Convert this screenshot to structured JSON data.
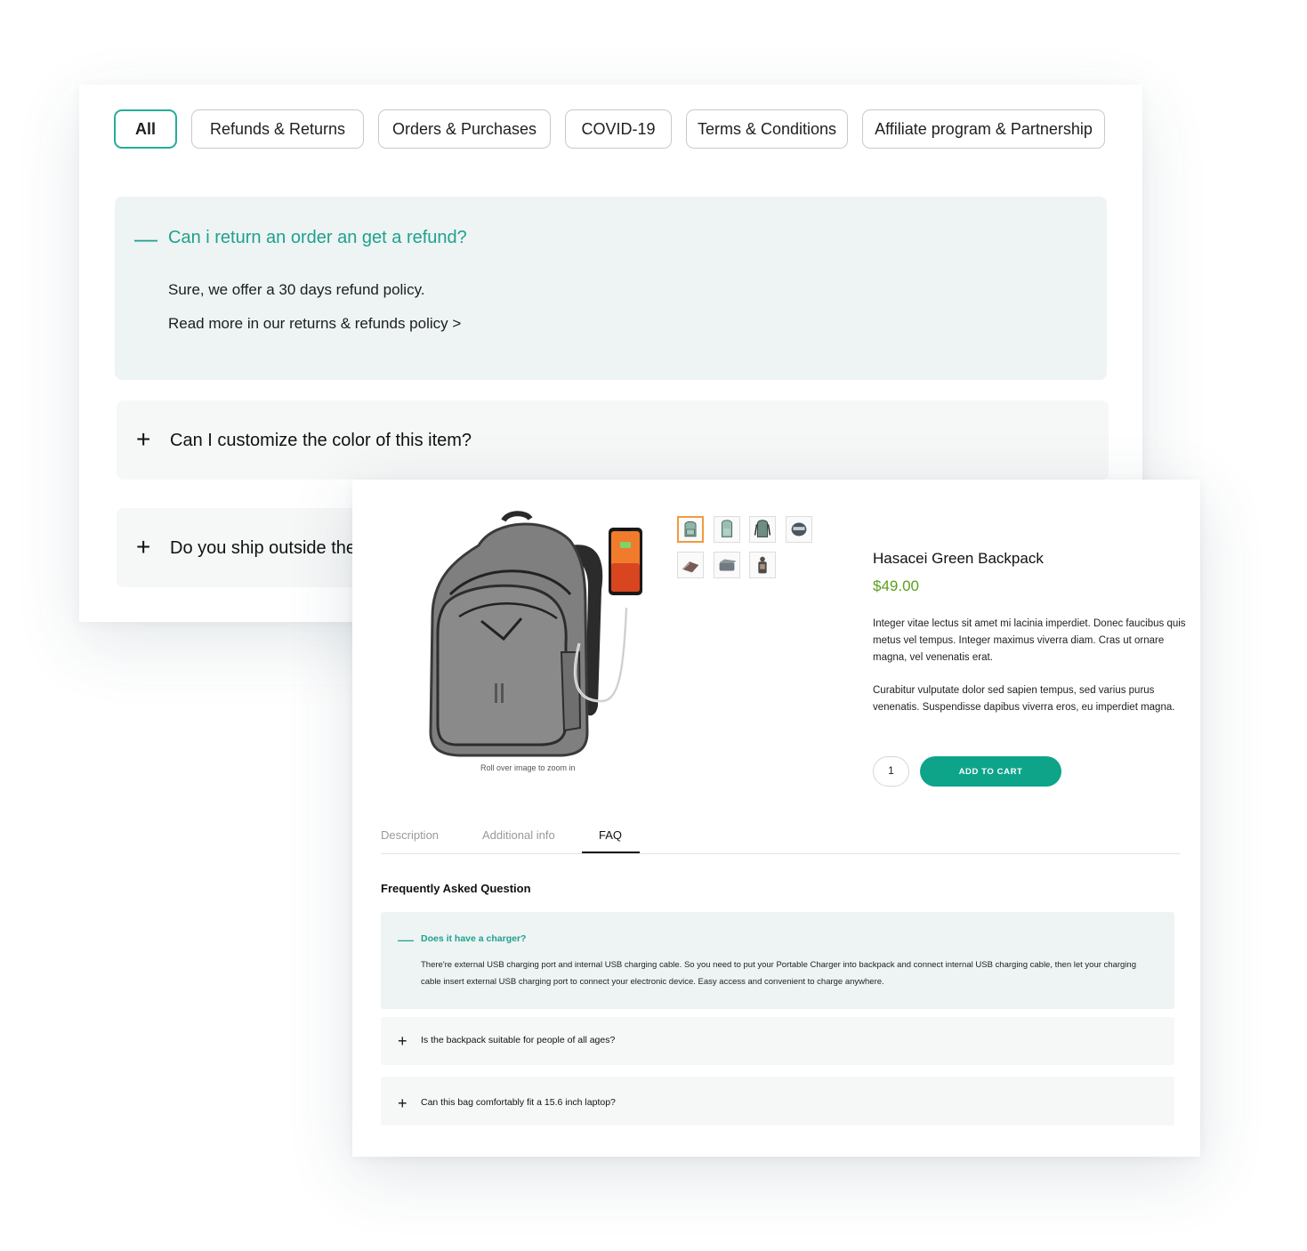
{
  "faq_page": {
    "filters": [
      {
        "label": "All",
        "active": true
      },
      {
        "label": "Refunds & Returns",
        "active": false
      },
      {
        "label": "Orders & Purchases",
        "active": false
      },
      {
        "label": "COVID-19",
        "active": false
      },
      {
        "label": "Terms & Conditions",
        "active": false
      },
      {
        "label": "Affiliate program & Partnership",
        "active": false
      }
    ],
    "items": [
      {
        "question": "Can i return an order an get a refund?",
        "expanded": true,
        "icon": "minus-icon",
        "answer_line1": "Sure, we offer a 30 days refund policy.",
        "answer_line2": "Read more in our returns & refunds policy >"
      },
      {
        "question": "Can I customize the color of this item?",
        "expanded": false,
        "icon": "plus-icon"
      },
      {
        "question": "Do you ship outside the",
        "expanded": false,
        "icon": "plus-icon"
      }
    ]
  },
  "product": {
    "title": "Hasacei Green Backpack",
    "price": "$49.00",
    "description_p1": "Integer vitae lectus sit amet mi lacinia imperdiet. Donec faucibus quis metus vel tempus. Integer maximus viverra diam. Cras ut ornare magna, vel venenatis erat.",
    "description_p2": "Curabitur vulputate dolor sed sapien tempus, sed varius purus venenatis. Suspendisse dapibus viverra eros, eu imperdiet magna.",
    "zoom_hint": "Roll over image to zoom in",
    "quantity": "1",
    "add_to_cart": "ADD TO CART",
    "thumbnails_count": 7,
    "tabs": [
      {
        "label": "Description",
        "active": false
      },
      {
        "label": "Additional info",
        "active": false
      },
      {
        "label": "FAQ",
        "active": true
      }
    ],
    "faq_heading": "Frequently Asked Question",
    "faq": [
      {
        "question": "Does it have a charger?",
        "expanded": true,
        "answer": "There're external USB charging port and internal USB charging cable. So you need to put your Portable Charger into backpack and connect internal USB charging cable, then let your charging cable insert external USB charging port to connect your electronic device. Easy access and convenient to charge anywhere."
      },
      {
        "question": "Is the backpack suitable for people of all ages?",
        "expanded": false
      },
      {
        "question": "Can this bag comfortably fit a 15.6 inch laptop?",
        "expanded": false
      }
    ]
  },
  "colors": {
    "accent": "#20a08f",
    "cart_button": "#0ea48a",
    "price": "#5aa01c",
    "open_item_bg": "#edf4f3",
    "closed_item_bg": "#f6f7f7",
    "active_thumb_border": "#f19a3e"
  }
}
